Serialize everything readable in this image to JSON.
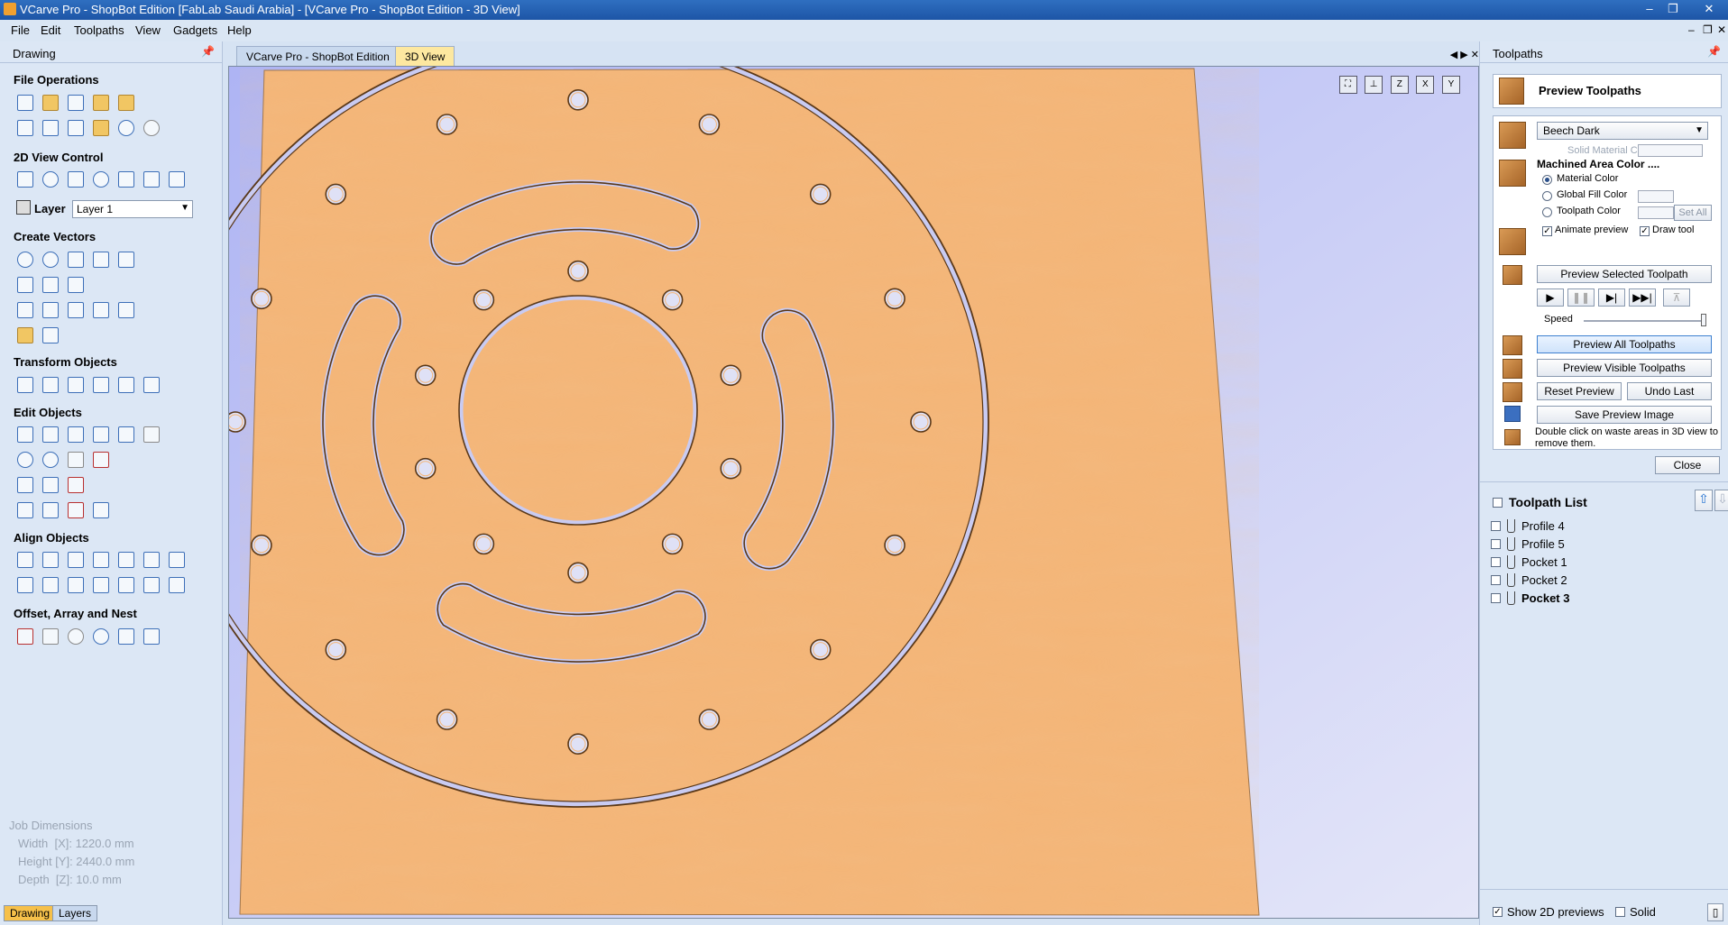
{
  "window": {
    "title": "VCarve Pro - ShopBot Edition [FabLab Saudi Arabia] - [VCarve Pro - ShopBot Edition - 3D View]"
  },
  "menu": [
    "File",
    "Edit",
    "Toolpaths",
    "View",
    "Gadgets",
    "Help"
  ],
  "left_panel": {
    "title": "Drawing",
    "sections": {
      "file_operations": "File Operations",
      "view_control": "2D View Control",
      "create_vectors": "Create Vectors",
      "transform_objects": "Transform Objects",
      "edit_objects": "Edit Objects",
      "align_objects": "Align Objects",
      "offset_array_nest": "Offset, Array and Nest"
    },
    "layer_label": "Layer",
    "layer_value": "Layer 1",
    "job_dimensions": {
      "title": "Job Dimensions",
      "width": "Width  [X]: 1220.0 mm",
      "height": "Height [Y]: 2440.0 mm",
      "depth": "Depth  [Z]: 10.0 mm"
    },
    "bottom_tabs": [
      "Drawing",
      "Layers"
    ]
  },
  "doc_tabs": [
    "VCarve Pro - ShopBot Edition",
    "3D View"
  ],
  "view_icons": [
    "zoom-fit-icon",
    "iso-view-icon",
    "z-view-icon",
    "x-view-icon",
    "y-view-icon"
  ],
  "right_panel": {
    "title": "Toolpaths",
    "header": "Preview Toolpaths",
    "material": "Beech Dark",
    "solid_material_color": "Solid Material Color",
    "machined_area_color": "Machined Area Color ....",
    "material_color": "Material Color",
    "global_fill_color": "Global Fill Color",
    "toolpath_color": "Toolpath Color",
    "set_all": "Set All",
    "animate_preview": "Animate preview",
    "draw_tool": "Draw tool",
    "preview_selected": "Preview Selected Toolpath",
    "speed": "Speed",
    "preview_all": "Preview All Toolpaths",
    "preview_visible": "Preview Visible Toolpaths",
    "reset_preview": "Reset Preview",
    "undo_last": "Undo Last",
    "save_preview_image": "Save Preview Image",
    "hint": "Double click on waste areas in 3D view to remove them.",
    "close": "Close",
    "toolpath_list_title": "Toolpath List",
    "toolpaths": [
      "Profile 4",
      "Profile 5",
      "Pocket 1",
      "Pocket 2",
      "Pocket 3"
    ],
    "show_2d_previews": "Show 2D previews",
    "solid": "Solid"
  },
  "colors": {
    "wood": "#f4b577",
    "background": "#b6bbf4",
    "groove": "#5a3818",
    "title_bar": "#1d55a6"
  }
}
